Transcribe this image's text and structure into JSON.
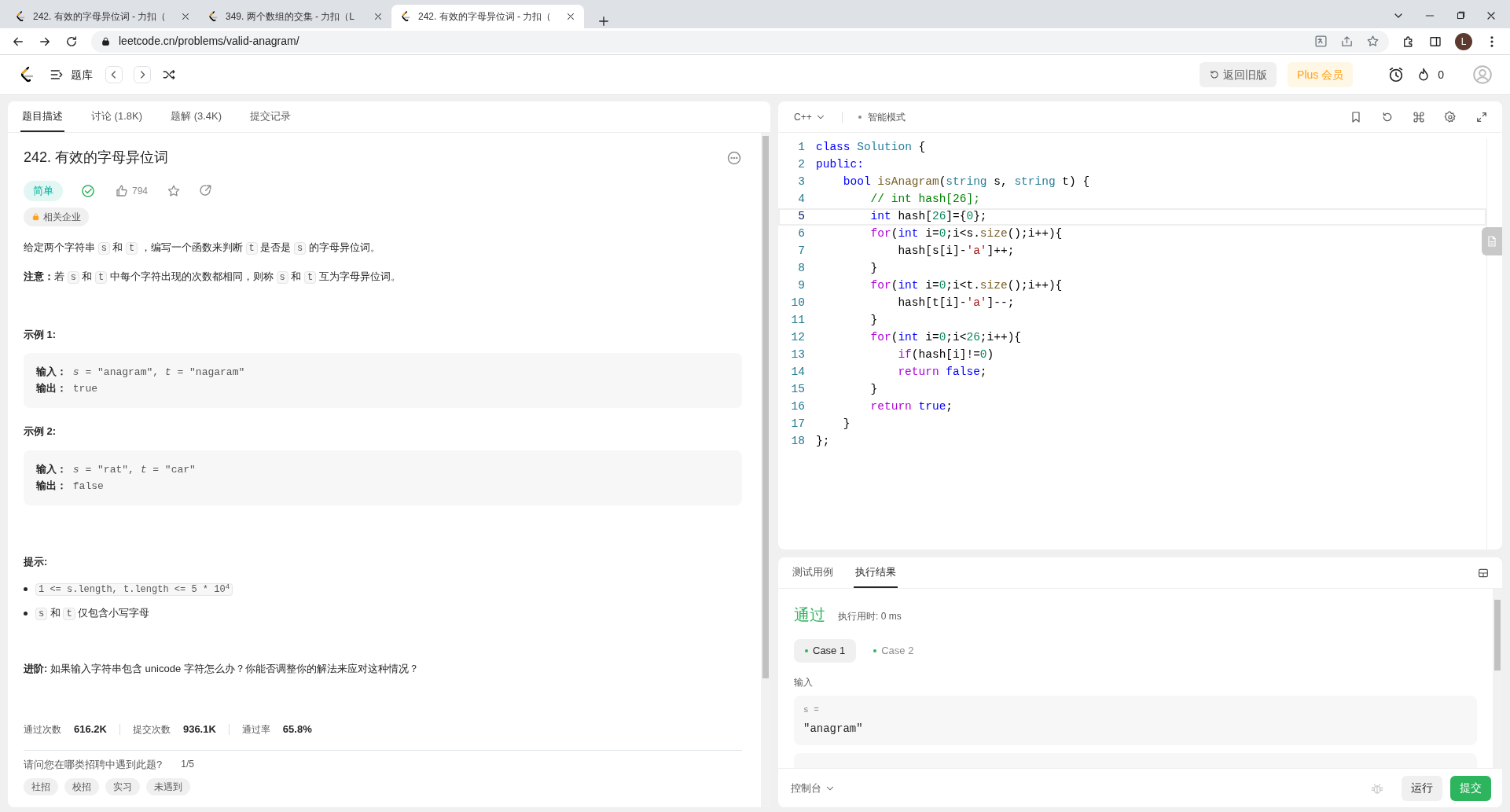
{
  "browser": {
    "tabs": [
      {
        "title": "242. 有效的字母异位词 - 力扣（",
        "selected": false
      },
      {
        "title": "349. 两个数组的交集 - 力扣（L",
        "selected": false
      },
      {
        "title": "242. 有效的字母异位词 - 力扣（",
        "selected": true
      }
    ],
    "url": "leetcode.cn/problems/valid-anagram/",
    "profile_initial": "L"
  },
  "app_header": {
    "problem_bank": "题库",
    "old_version": "返回旧版",
    "plus": "Plus 会员",
    "streak": "0"
  },
  "description": {
    "tabs": [
      {
        "label": "题目描述",
        "selected": true
      },
      {
        "label": "讨论 (1.8K)",
        "selected": false
      },
      {
        "label": "题解 (3.4K)",
        "selected": false
      },
      {
        "label": "提交记录",
        "selected": false
      }
    ],
    "title": "242. 有效的字母异位词",
    "difficulty": "简单",
    "solved": true,
    "likes": "794",
    "companies": "相关企业",
    "paragraphs": [
      [
        {
          "kind": "text",
          "text": "给定两个字符串 "
        },
        {
          "kind": "code",
          "text": "s"
        },
        {
          "kind": "text",
          "text": " 和 "
        },
        {
          "kind": "code",
          "text": "t"
        },
        {
          "kind": "text",
          "text": " ，编写一个函数来判断 "
        },
        {
          "kind": "code",
          "text": "t"
        },
        {
          "kind": "text",
          "text": " 是否是 "
        },
        {
          "kind": "code",
          "text": "s"
        },
        {
          "kind": "text",
          "text": " 的字母异位词。"
        }
      ],
      [
        {
          "kind": "bold",
          "text": "注意："
        },
        {
          "kind": "text",
          "text": "若 "
        },
        {
          "kind": "code",
          "text": "s"
        },
        {
          "kind": "text",
          "text": " 和 "
        },
        {
          "kind": "code",
          "text": "t"
        },
        {
          "kind": "text",
          "text": " 中每个字符出现的次数都相同，则称 "
        },
        {
          "kind": "code",
          "text": "s"
        },
        {
          "kind": "text",
          "text": " 和 "
        },
        {
          "kind": "code",
          "text": "t"
        },
        {
          "kind": "text",
          "text": " 互为字母异位词。"
        }
      ]
    ],
    "examples": [
      {
        "heading": "示例 1:",
        "lines": [
          "**输入：** *s* = \"anagram\", *t* = \"nagaram\"",
          "**输出：** true"
        ]
      },
      {
        "heading": "示例 2:",
        "lines": [
          "**输入：** *s* = \"rat\", *t* = \"car\"",
          "**输出：** false"
        ]
      }
    ],
    "hints_heading": "提示:",
    "hints": [
      [
        {
          "kind": "code",
          "text": "1 <= s.length, t.length <= 5 * 10$^{4}$"
        }
      ],
      [
        {
          "kind": "code",
          "text": "s"
        },
        {
          "kind": "text",
          "text": " 和 "
        },
        {
          "kind": "code",
          "text": "t"
        },
        {
          "kind": "text",
          "text": " 仅包含小写字母"
        }
      ]
    ],
    "follow_up": "**进阶:** 如果输入字符串包含 unicode 字符怎么办？你能否调整你的解法来应对这种情况？",
    "stats": [
      {
        "label": "通过次数",
        "value": "616.2K"
      },
      {
        "label": "提交次数",
        "value": "936.1K"
      },
      {
        "label": "通过率",
        "value": "65.8%"
      }
    ],
    "survey": {
      "question": "请问您在哪类招聘中遇到此题?",
      "progress": "1/5",
      "options": [
        "社招",
        "校招",
        "实习",
        "未遇到"
      ]
    }
  },
  "editor": {
    "language": "C++",
    "mode": "智能模式",
    "lines": [
      {
        "number": "1",
        "current": false,
        "tokens": [
          {
            "kind": "kw",
            "text": "class"
          },
          {
            "kind": "type",
            "text": " Solution"
          },
          {
            "kind": "plain",
            "text": " {"
          }
        ]
      },
      {
        "number": "2",
        "current": false,
        "tokens": [
          {
            "kind": "kw",
            "text": "public:"
          }
        ]
      },
      {
        "number": "3",
        "current": false,
        "tokens": [
          {
            "kind": "kw",
            "text": "    bool"
          },
          {
            "kind": "fn",
            "text": " isAnagram"
          },
          {
            "kind": "plain",
            "text": "("
          },
          {
            "kind": "type",
            "text": "string"
          },
          {
            "kind": "plain",
            "text": " s, "
          },
          {
            "kind": "type",
            "text": "string"
          },
          {
            "kind": "plain",
            "text": " t) {"
          }
        ]
      },
      {
        "number": "4",
        "current": false,
        "tokens": [
          {
            "kind": "comment",
            "text": "        // int hash[26];"
          }
        ]
      },
      {
        "number": "5",
        "current": true,
        "tokens": [
          {
            "kind": "kw",
            "text": "        int"
          },
          {
            "kind": "plain",
            "text": " hash["
          },
          {
            "kind": "num",
            "text": "26"
          },
          {
            "kind": "plain",
            "text": "]={"
          },
          {
            "kind": "num",
            "text": "0"
          },
          {
            "kind": "plain",
            "text": "};"
          }
        ]
      },
      {
        "number": "6",
        "current": false,
        "tokens": [
          {
            "kind": "ctrl",
            "text": "        for"
          },
          {
            "kind": "plain",
            "text": "("
          },
          {
            "kind": "kw",
            "text": "int"
          },
          {
            "kind": "plain",
            "text": " i="
          },
          {
            "kind": "num",
            "text": "0"
          },
          {
            "kind": "plain",
            "text": ";i<s."
          },
          {
            "kind": "fn",
            "text": "size"
          },
          {
            "kind": "plain",
            "text": "();i++){"
          }
        ]
      },
      {
        "number": "7",
        "current": false,
        "tokens": [
          {
            "kind": "plain",
            "text": "            hash[s[i]-"
          },
          {
            "kind": "str",
            "text": "'a'"
          },
          {
            "kind": "plain",
            "text": "]++;"
          }
        ]
      },
      {
        "number": "8",
        "current": false,
        "tokens": [
          {
            "kind": "plain",
            "text": "        }"
          }
        ]
      },
      {
        "number": "9",
        "current": false,
        "tokens": [
          {
            "kind": "ctrl",
            "text": "        for"
          },
          {
            "kind": "plain",
            "text": "("
          },
          {
            "kind": "kw",
            "text": "int"
          },
          {
            "kind": "plain",
            "text": " i="
          },
          {
            "kind": "num",
            "text": "0"
          },
          {
            "kind": "plain",
            "text": ";i<t."
          },
          {
            "kind": "fn",
            "text": "size"
          },
          {
            "kind": "plain",
            "text": "();i++){"
          }
        ]
      },
      {
        "number": "10",
        "current": false,
        "tokens": [
          {
            "kind": "plain",
            "text": "            hash[t[i]-"
          },
          {
            "kind": "str",
            "text": "'a'"
          },
          {
            "kind": "plain",
            "text": "]--;"
          }
        ]
      },
      {
        "number": "11",
        "current": false,
        "tokens": [
          {
            "kind": "plain",
            "text": "        }"
          }
        ]
      },
      {
        "number": "12",
        "current": false,
        "tokens": [
          {
            "kind": "ctrl",
            "text": "        for"
          },
          {
            "kind": "plain",
            "text": "("
          },
          {
            "kind": "kw",
            "text": "int"
          },
          {
            "kind": "plain",
            "text": " i="
          },
          {
            "kind": "num",
            "text": "0"
          },
          {
            "kind": "plain",
            "text": ";i<"
          },
          {
            "kind": "num",
            "text": "26"
          },
          {
            "kind": "plain",
            "text": ";i++){"
          }
        ]
      },
      {
        "number": "13",
        "current": false,
        "tokens": [
          {
            "kind": "ctrl",
            "text": "            if"
          },
          {
            "kind": "plain",
            "text": "(hash[i]!="
          },
          {
            "kind": "num",
            "text": "0"
          },
          {
            "kind": "plain",
            "text": ")"
          }
        ]
      },
      {
        "number": "14",
        "current": false,
        "tokens": [
          {
            "kind": "ctrl",
            "text": "            return"
          },
          {
            "kind": "kw",
            "text": " false"
          },
          {
            "kind": "plain",
            "text": ";"
          }
        ]
      },
      {
        "number": "15",
        "current": false,
        "tokens": [
          {
            "kind": "plain",
            "text": "        }"
          }
        ]
      },
      {
        "number": "16",
        "current": false,
        "tokens": [
          {
            "kind": "ctrl",
            "text": "        return"
          },
          {
            "kind": "kw",
            "text": " true"
          },
          {
            "kind": "plain",
            "text": ";"
          }
        ]
      },
      {
        "number": "17",
        "current": false,
        "tokens": [
          {
            "kind": "plain",
            "text": "    }"
          }
        ]
      },
      {
        "number": "18",
        "current": false,
        "tokens": [
          {
            "kind": "plain",
            "text": "};"
          }
        ]
      }
    ]
  },
  "console": {
    "tabs": [
      {
        "label": "测试用例",
        "selected": false
      },
      {
        "label": "执行结果",
        "selected": true
      }
    ],
    "status": "通过",
    "runtime": "执行用时: 0 ms",
    "cases": [
      {
        "label": "Case 1",
        "selected": true,
        "passed": true
      },
      {
        "label": "Case 2",
        "selected": false,
        "passed": true
      }
    ],
    "input_label": "输入",
    "inputs": [
      {
        "name": "s =",
        "value": "\"anagram\""
      }
    ],
    "console_toggle": "控制台",
    "run": "运行",
    "submit": "提交"
  }
}
